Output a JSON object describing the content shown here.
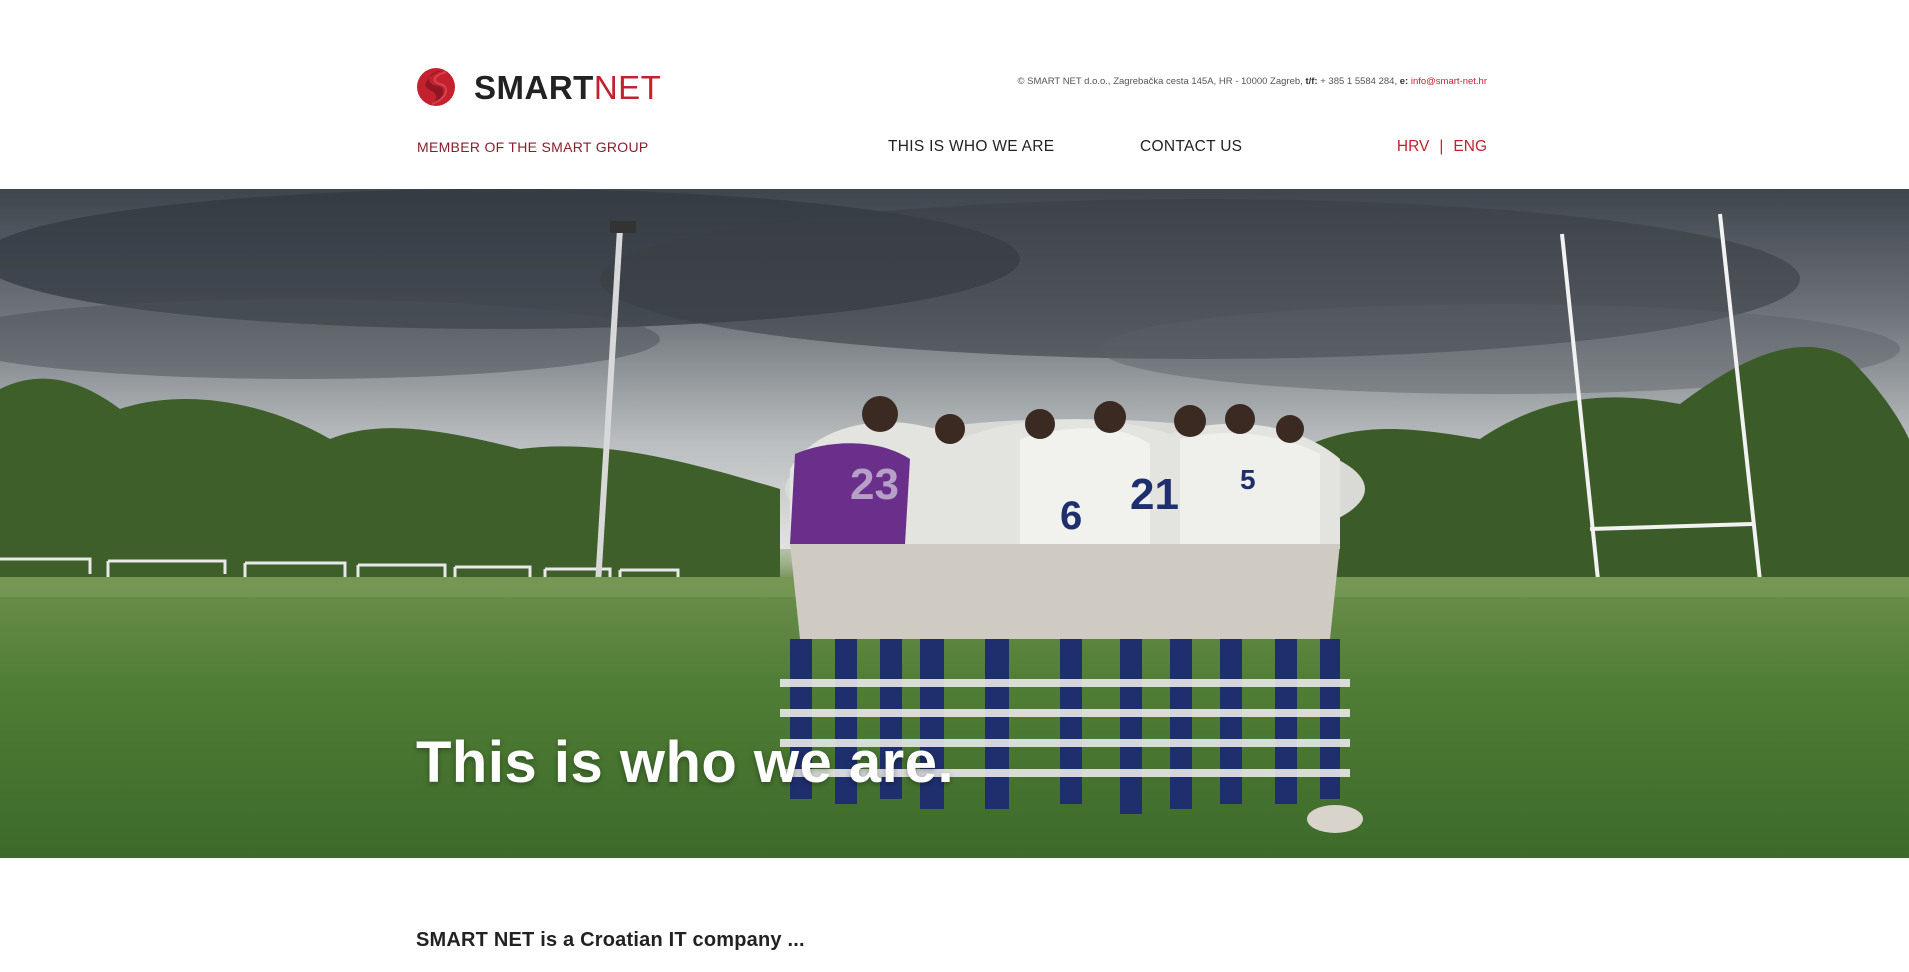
{
  "header": {
    "logo_bold": "SMART",
    "logo_light": "NET",
    "member_text": "MEMBER OF THE SMART GROUP",
    "contact_prefix": "© SMART NET d.o.o., Zagrebačka cesta 145A, HR - 10000 Zagreb,",
    "contact_phone_label": "t/f:",
    "contact_phone": "+ 385 1 5584 284,",
    "contact_email_label": "e:",
    "contact_email": "info@smart-net.hr"
  },
  "nav": {
    "who_we_are": "THIS IS WHO WE ARE",
    "contact_us": "CONTACT US"
  },
  "lang": {
    "hrv": "HRV",
    "separator": "|",
    "eng": "ENG"
  },
  "hero": {
    "title": "This is who we are."
  },
  "content": {
    "intro": "SMART NET is a Croatian IT company ..."
  },
  "colors": {
    "brand_red": "#c4212f",
    "text_dark": "#222222"
  },
  "icons": {
    "logo": "smartnet-logo-icon"
  }
}
